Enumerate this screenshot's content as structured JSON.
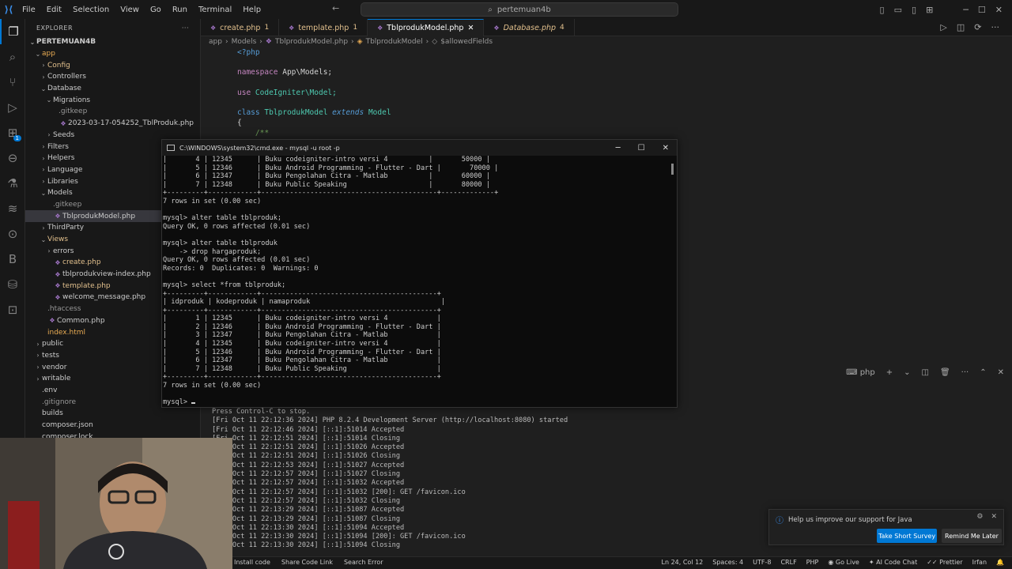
{
  "titlebar": {
    "menu": [
      "File",
      "Edit",
      "Selection",
      "View",
      "Go",
      "Run",
      "Terminal",
      "Help"
    ],
    "search": "pertemuan4b"
  },
  "explorer": {
    "title": "EXPLORER",
    "root": "PERTEMUAN4B",
    "items": [
      {
        "label": "app",
        "depth": 1,
        "chev": "v",
        "color": "c-orange"
      },
      {
        "label": "Config",
        "depth": 2,
        "chev": ">",
        "color": "c-yellow"
      },
      {
        "label": "Controllers",
        "depth": 2,
        "chev": ">",
        "color": ""
      },
      {
        "label": "Database",
        "depth": 2,
        "chev": "v",
        "color": ""
      },
      {
        "label": "Migrations",
        "depth": 3,
        "chev": "v",
        "color": ""
      },
      {
        "label": ".gitkeep",
        "depth": 4,
        "chev": "",
        "color": "c-gray"
      },
      {
        "label": "2023-03-17-054252_TblProduk.php",
        "depth": 4,
        "chev": "",
        "color": "",
        "php": true
      },
      {
        "label": "Seeds",
        "depth": 3,
        "chev": ">",
        "color": ""
      },
      {
        "label": "Filters",
        "depth": 2,
        "chev": ">",
        "color": ""
      },
      {
        "label": "Helpers",
        "depth": 2,
        "chev": ">",
        "color": ""
      },
      {
        "label": "Language",
        "depth": 2,
        "chev": ">",
        "color": ""
      },
      {
        "label": "Libraries",
        "depth": 2,
        "chev": ">",
        "color": ""
      },
      {
        "label": "Models",
        "depth": 2,
        "chev": "v",
        "color": ""
      },
      {
        "label": ".gitkeep",
        "depth": 3,
        "chev": "",
        "color": "c-gray"
      },
      {
        "label": "TblprodukModel.php",
        "depth": 3,
        "chev": "",
        "color": "",
        "php": true,
        "selected": true
      },
      {
        "label": "ThirdParty",
        "depth": 2,
        "chev": ">",
        "color": ""
      },
      {
        "label": "Views",
        "depth": 2,
        "chev": "v",
        "color": "c-yellow"
      },
      {
        "label": "errors",
        "depth": 3,
        "chev": ">",
        "color": ""
      },
      {
        "label": "create.php",
        "depth": 3,
        "chev": "",
        "color": "c-yellow",
        "php": true
      },
      {
        "label": "tblprodukview-index.php",
        "depth": 3,
        "chev": "",
        "color": "",
        "php": true
      },
      {
        "label": "template.php",
        "depth": 3,
        "chev": "",
        "color": "c-yellow",
        "php": true
      },
      {
        "label": "welcome_message.php",
        "depth": 3,
        "chev": "",
        "color": "",
        "php": true
      },
      {
        "label": ".htaccess",
        "depth": 2,
        "chev": "",
        "color": "c-gray"
      },
      {
        "label": "Common.php",
        "depth": 2,
        "chev": "",
        "color": "",
        "php": true
      },
      {
        "label": "index.html",
        "depth": 2,
        "chev": "",
        "color": "c-orange"
      },
      {
        "label": "public",
        "depth": 1,
        "chev": ">",
        "color": ""
      },
      {
        "label": "tests",
        "depth": 1,
        "chev": ">",
        "color": ""
      },
      {
        "label": "vendor",
        "depth": 1,
        "chev": ">",
        "color": ""
      },
      {
        "label": "writable",
        "depth": 1,
        "chev": ">",
        "color": ""
      },
      {
        "label": ".env",
        "depth": 1,
        "chev": "",
        "color": ""
      },
      {
        "label": ".gitignore",
        "depth": 1,
        "chev": "",
        "color": "c-gray"
      },
      {
        "label": "builds",
        "depth": 1,
        "chev": "",
        "color": ""
      },
      {
        "label": "composer.json",
        "depth": 1,
        "chev": "",
        "color": ""
      },
      {
        "label": "composer.lock",
        "depth": 1,
        "chev": "",
        "color": ""
      }
    ]
  },
  "tabs": [
    {
      "label": "create.php",
      "count": "1",
      "active": false,
      "italic": false
    },
    {
      "label": "template.php",
      "count": "1",
      "active": false,
      "italic": false
    },
    {
      "label": "TblprodukModel.php",
      "count": "",
      "active": true,
      "italic": false
    },
    {
      "label": "Database.php",
      "count": "4",
      "active": false,
      "italic": true
    }
  ],
  "breadcrumb": [
    "app",
    "Models",
    "TblprodukModel.php",
    "TblprodukModel",
    "$allowedFields"
  ],
  "code": {
    "open_tag": "<?php",
    "ns_kw": "namespace",
    "ns_val": "App\\Models;",
    "use_kw": "use",
    "use_cls": "CodeIgniter",
    "use_rest": "\\Model;",
    "class_kw": "class",
    "class_name": "TblprodukModel",
    "extends_kw": "extends",
    "parent": "Model",
    "brace": "{",
    "comment": "    /**"
  },
  "cmd": {
    "title": "C:\\WINDOWS\\system32\\cmd.exe - mysql  -u root -p",
    "lines": [
      "|       4 | 12345      | Buku codeigniter-intro versi 4          |       50000 |",
      "|       5 | 12346      | Buku Android Programming - Flutter - Dart |       70000 |",
      "|       6 | 12347      | Buku Pengolahan Citra - Matlab          |       60000 |",
      "|       7 | 12348      | Buku Public Speaking                    |       80000 |",
      "+---------+------------+-------------------------------------------+-------------+",
      "7 rows in set (0.00 sec)",
      "",
      "mysql> alter table tblproduk;",
      "Query OK, 0 rows affected (0.01 sec)",
      "",
      "mysql> alter table tblproduk",
      "    -> drop hargaproduk;",
      "Query OK, 0 rows affected (0.01 sec)",
      "Records: 0  Duplicates: 0  Warnings: 0",
      "",
      "mysql> select *from tblproduk;",
      "+---------+------------+-------------------------------------------+",
      "| idproduk | kodeproduk | namaproduk                                |",
      "+---------+------------+-------------------------------------------+",
      "|       1 | 12345      | Buku codeigniter-intro versi 4            |",
      "|       2 | 12346      | Buku Android Programming - Flutter - Dart |",
      "|       3 | 12347      | Buku Pengolahan Citra - Matlab            |",
      "|       4 | 12345      | Buku codeigniter-intro versi 4            |",
      "|       5 | 12346      | Buku Android Programming - Flutter - Dart |",
      "|       6 | 12347      | Buku Pengolahan Citra - Matlab            |",
      "|       7 | 12348      | Buku Public Speaking                      |",
      "+---------+------------+-------------------------------------------+",
      "7 rows in set (0.00 sec)",
      ""
    ],
    "prompt": "mysql> "
  },
  "terminal": {
    "panel_label": "php",
    "lines": [
      "Press Control-C to stop.",
      "[Fri Oct 11 22:12:36 2024] PHP 8.2.4 Development Server (http://localhost:8080) started",
      "[Fri Oct 11 22:12:46 2024] [::1]:51014 Accepted",
      "[Fri Oct 11 22:12:51 2024] [::1]:51014 Closing",
      "[Fri Oct 11 22:12:51 2024] [::1]:51026 Accepted",
      "[Fri Oct 11 22:12:51 2024] [::1]:51026 Closing",
      "[Fri Oct 11 22:12:53 2024] [::1]:51027 Accepted",
      "[Fri Oct 11 22:12:57 2024] [::1]:51027 Closing",
      "[Fri Oct 11 22:12:57 2024] [::1]:51032 Accepted",
      "[Fri Oct 11 22:12:57 2024] [::1]:51032 [200]: GET /favicon.ico",
      "[Fri Oct 11 22:12:57 2024] [::1]:51032 Closing",
      "[Fri Oct 11 22:13:29 2024] [::1]:51087 Accepted",
      "[Fri Oct 11 22:13:29 2024] [::1]:51087 Closing",
      "[Fri Oct 11 22:13:30 2024] [::1]:51094 Accepted",
      "[Fri Oct 11 22:13:30 2024] [::1]:51094 [200]: GET /favicon.ico",
      "[Fri Oct 11 22:13:30 2024] [::1]:51094 Closing"
    ]
  },
  "statusbar": {
    "left": [
      "Install code",
      "Share Code Link",
      "Search Error"
    ],
    "right": [
      "Ln 24, Col 12",
      "Spaces: 4",
      "UTF-8",
      "CRLF",
      "PHP",
      "Go Live",
      "AI Code Chat",
      "Prettier",
      "Irfan"
    ]
  },
  "notification": {
    "message": "Help us improve our support for Java",
    "primary": "Take Short Survey",
    "secondary": "Remind Me Later"
  },
  "colors": {
    "accent": "#0078d4",
    "editor_bg": "#1f1f1f",
    "terminal_bg": "#0c0c0c"
  }
}
